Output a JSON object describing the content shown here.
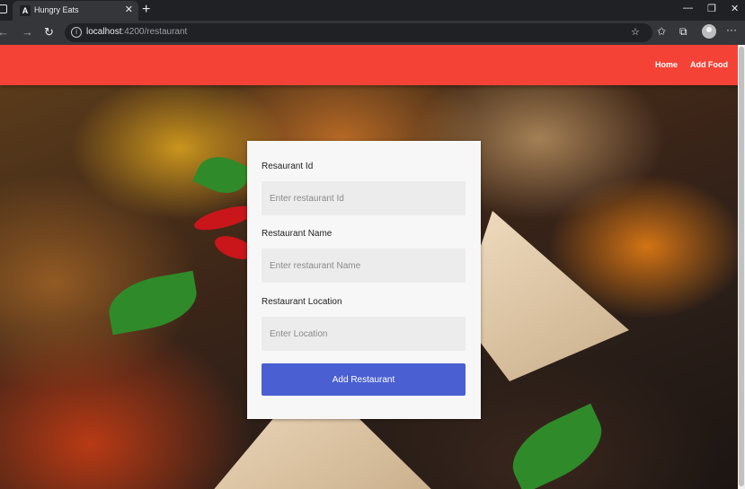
{
  "browser": {
    "tab_title": "Hungry Eats",
    "tab_favicon_letter": "A",
    "url_host": "localhost",
    "url_path": ":4200/restaurant"
  },
  "navbar": {
    "color": "#f44336",
    "links": [
      "Home",
      "Add Food"
    ]
  },
  "form": {
    "fields": [
      {
        "label": "Resaurant Id",
        "placeholder": "Enter restaurant Id",
        "value": ""
      },
      {
        "label": "Restaurant Name",
        "placeholder": "Enter restaurant Name",
        "value": ""
      },
      {
        "label": "Restaurant Location",
        "placeholder": "Enter Location",
        "value": ""
      }
    ],
    "submit_label": "Add Restaurant",
    "submit_color": "#4a5fd1"
  },
  "icons": [
    "back-icon",
    "forward-icon",
    "reload-icon",
    "info-icon",
    "favorites-add-icon",
    "favorites-icon",
    "collections-icon",
    "profile-icon",
    "more-icon"
  ]
}
